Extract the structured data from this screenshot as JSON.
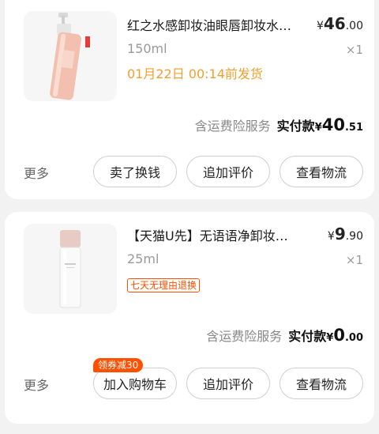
{
  "orders": [
    {
      "title": "红之水感卸妆油眼唇卸妆水…",
      "price": {
        "currency": "¥",
        "integer": "46",
        "decimal": ".00"
      },
      "spec": "150ml",
      "quantity": "×1",
      "ship_notice": "01月22日 00:14前发货",
      "insurance": "含运费险服务",
      "paid": {
        "label": "实付款",
        "currency": "¥",
        "integer": "40",
        "decimal": ".51"
      },
      "more": "更多",
      "buttons": [
        "卖了换钱",
        "追加评价",
        "查看物流"
      ],
      "thumb_colors": {
        "bottle": "#f2c2b4",
        "cap": "#e8e8e8"
      }
    },
    {
      "title": "【天猫U先】无语语净卸妆…",
      "price": {
        "currency": "¥",
        "integer": "9",
        "decimal": ".90"
      },
      "spec": "25ml",
      "quantity": "×1",
      "tag": "七天无理由退换",
      "insurance": "含运费险服务",
      "paid": {
        "label": "实付款",
        "currency": "¥",
        "integer": "0",
        "decimal": ".00"
      },
      "more": "更多",
      "coupon": "领券减30",
      "buttons": [
        "加入购物车",
        "追加评价",
        "查看物流"
      ],
      "thumb_colors": {
        "bottle": "#f4f4f4",
        "cap": "#e7c9c4"
      }
    }
  ],
  "accent_color": "#ff5000",
  "ship_color": "#f0a030"
}
